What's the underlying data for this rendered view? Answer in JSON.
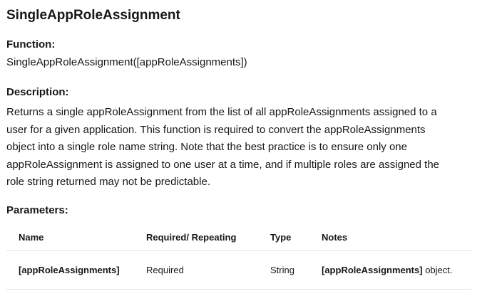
{
  "title": "SingleAppRoleAssignment",
  "function": {
    "label": "Function:",
    "signature": "SingleAppRoleAssignment([appRoleAssignments])"
  },
  "description": {
    "label": "Description:",
    "lines": [
      "Returns a single appRoleAssignment from the list of all appRoleAssignments assigned to a",
      "user for a given application. This function is required to convert the appRoleAssignments",
      "object into a single role name string. Note that the best practice is to ensure only one",
      "appRoleAssignment is assigned to one user at a time, and if multiple roles are assigned the",
      "role string returned may not be predictable."
    ]
  },
  "parameters": {
    "label": "Parameters:",
    "headers": [
      "Name",
      "Required/ Repeating",
      "Type",
      "Notes"
    ],
    "rows": [
      {
        "name": "[appRoleAssignments]",
        "required": "Required",
        "type": "String",
        "notes_bold": "[appRoleAssignments]",
        "notes_rest": " object."
      }
    ]
  }
}
